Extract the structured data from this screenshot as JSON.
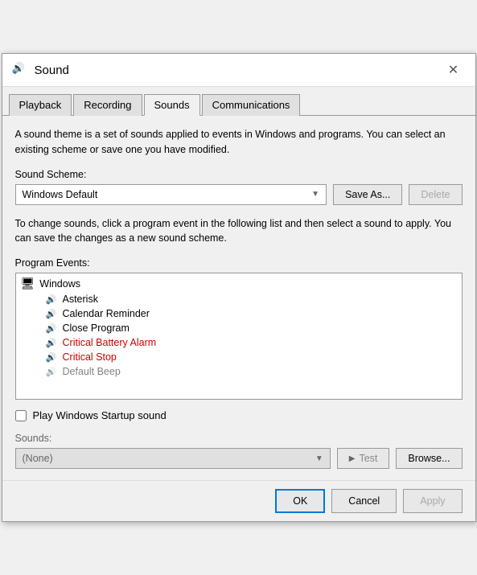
{
  "dialog": {
    "title": "Sound",
    "icon": "🔊"
  },
  "tabs": [
    {
      "id": "playback",
      "label": "Playback"
    },
    {
      "id": "recording",
      "label": "Recording"
    },
    {
      "id": "sounds",
      "label": "Sounds",
      "active": true
    },
    {
      "id": "communications",
      "label": "Communications"
    }
  ],
  "sounds_tab": {
    "description": "A sound theme is a set of sounds applied to events in Windows and programs.  You can select an existing scheme or save one you have modified.",
    "sound_scheme_label": "Sound Scheme:",
    "scheme_value": "Windows Default",
    "save_as_label": "Save As...",
    "delete_label": "Delete",
    "info_text": "To change sounds, click a program event in the following list and then select a sound to apply.  You can save the changes as a new sound scheme.",
    "program_events_label": "Program Events:",
    "events": [
      {
        "id": "windows-group",
        "type": "group",
        "label": "Windows",
        "indent": 0
      },
      {
        "id": "asterisk",
        "type": "item",
        "label": "Asterisk",
        "has_sound": true
      },
      {
        "id": "calendar-reminder",
        "type": "item",
        "label": "Calendar Reminder",
        "has_sound": true
      },
      {
        "id": "close-program",
        "type": "item",
        "label": "Close Program",
        "has_sound": false
      },
      {
        "id": "critical-battery-alarm",
        "type": "item",
        "label": "Critical Battery Alarm",
        "has_sound": true,
        "color": "#cc0000"
      },
      {
        "id": "critical-stop",
        "type": "item",
        "label": "Critical Stop",
        "has_sound": true,
        "color": "#cc0000"
      },
      {
        "id": "default-beep",
        "type": "item",
        "label": "Default Beep",
        "has_sound": false
      }
    ],
    "play_startup_label": "Play Windows Startup sound",
    "play_startup_checked": false,
    "sounds_label": "Sounds:",
    "sounds_value": "(None)",
    "test_label": "Test",
    "browse_label": "Browse..."
  },
  "footer": {
    "ok_label": "OK",
    "cancel_label": "Cancel",
    "apply_label": "Apply"
  }
}
